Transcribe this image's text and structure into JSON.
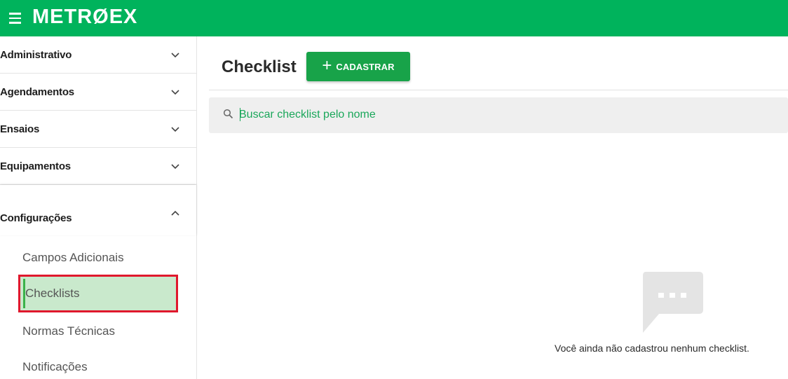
{
  "app": {
    "logo": "METRØEX"
  },
  "sidebar": {
    "groups": [
      {
        "label": "Administrativo"
      },
      {
        "label": "Agendamentos"
      },
      {
        "label": "Ensaios"
      },
      {
        "label": "Equipamentos"
      },
      {
        "label": "Configurações"
      }
    ],
    "subitems": [
      {
        "label": "Campos Adicionais"
      },
      {
        "label": "Checklists"
      },
      {
        "label": "Normas Técnicas"
      },
      {
        "label": "Notificações"
      }
    ]
  },
  "main": {
    "title": "Checklist",
    "add_button": "CADASTRAR",
    "search": {
      "placeholder": "Buscar checklist pelo nome",
      "value": ""
    },
    "empty_message": "Você ainda não cadastrou nenhum checklist."
  },
  "colors": {
    "brand_green": "#00b35c",
    "button_green": "#18a349",
    "highlight_red": "#e0182d",
    "active_bg": "#c9e9cc"
  },
  "icons": {
    "menu": "hamburger-menu-icon",
    "chevron_down": "chevron-down-icon",
    "chevron_up": "chevron-up-icon",
    "search": "search-icon",
    "plus": "plus-icon",
    "empty": "chat-bubble-icon"
  }
}
